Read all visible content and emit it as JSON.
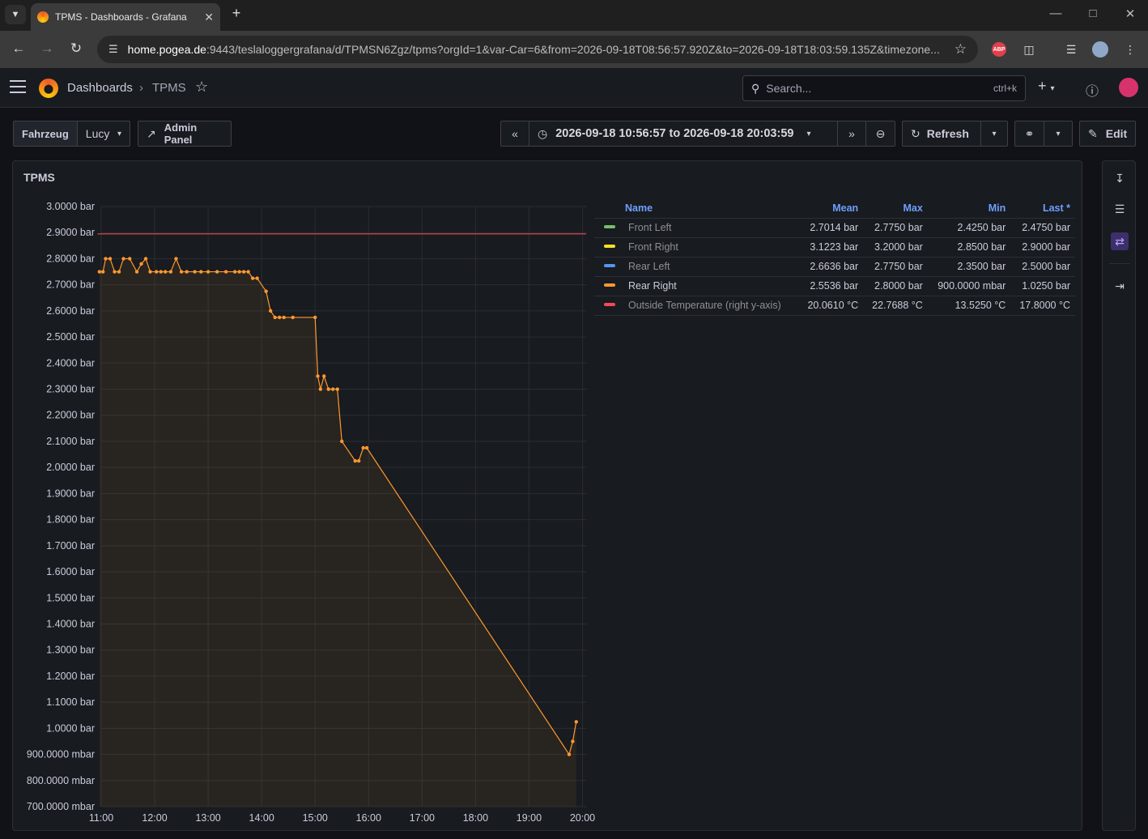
{
  "browser": {
    "tab_title": "TPMS - Dashboards - Grafana",
    "url_host": "home.pogea.de",
    "url_rest": ":9443/teslaloggergrafana/d/TPMSN6Zgz/tpms?orgId=1&var-Car=6&from=2026-09-18T08:56:57.920Z&to=2026-09-18T18:03:59.135Z&timezone..."
  },
  "header": {
    "breadcrumb_root": "Dashboards",
    "breadcrumb_sep": "›",
    "breadcrumb_current": "TPMS",
    "search_placeholder": "Search...",
    "search_shortcut": "ctrl+k"
  },
  "controls": {
    "var_label": "Fahrzeug",
    "var_value": "Lucy",
    "admin_panel": "Admin Panel",
    "time_range": "2026-09-18 10:56:57 to 2026-09-18 20:03:59",
    "refresh": "Refresh",
    "edit": "Edit"
  },
  "panel": {
    "title": "TPMS"
  },
  "legend": {
    "headers": [
      "Name",
      "Mean",
      "Max",
      "Min",
      "Last *"
    ],
    "rows": [
      {
        "name": "Front Left",
        "color": "#73bf69",
        "mean": "2.7014 bar",
        "max": "2.7750 bar",
        "min": "2.4250 bar",
        "last": "2.4750 bar"
      },
      {
        "name": "Front Right",
        "color": "#fade2a",
        "mean": "3.1223 bar",
        "max": "3.2000 bar",
        "min": "2.8500 bar",
        "last": "2.9000 bar"
      },
      {
        "name": "Rear Left",
        "color": "#5794f2",
        "mean": "2.6636 bar",
        "max": "2.7750 bar",
        "min": "2.3500 bar",
        "last": "2.5000 bar"
      },
      {
        "name": "Rear Right",
        "color": "#ff9830",
        "mean": "2.5536 bar",
        "max": "2.8000 bar",
        "min": "900.0000 mbar",
        "last": "1.0250 bar"
      },
      {
        "name": "Outside Temperature (right y-axis)",
        "color": "#f2495c",
        "mean": "20.0610 °C",
        "max": "22.7688 °C",
        "min": "13.5250 °C",
        "last": "17.8000 °C"
      }
    ]
  },
  "chart_data": {
    "type": "line",
    "title": "TPMS",
    "ylim": [
      0.7,
      3.0
    ],
    "y_ticks": [
      "700.0000 mbar",
      "800.0000 mbar",
      "900.0000 mbar",
      "1.0000 bar",
      "1.1000 bar",
      "1.2000 bar",
      "1.3000 bar",
      "1.4000 bar",
      "1.5000 bar",
      "1.6000 bar",
      "1.7000 bar",
      "1.8000 bar",
      "1.9000 bar",
      "2.0000 bar",
      "2.1000 bar",
      "2.2000 bar",
      "2.3000 bar",
      "2.4000 bar",
      "2.5000 bar",
      "2.6000 bar",
      "2.7000 bar",
      "2.8000 bar",
      "2.9000 bar",
      "3.0000 bar"
    ],
    "x_ticks": [
      "11:00",
      "12:00",
      "13:00",
      "14:00",
      "15:00",
      "16:00",
      "17:00",
      "18:00",
      "19:00",
      "20:00"
    ],
    "xlim": [
      "11:00",
      "20:05"
    ],
    "grid": true,
    "series": [
      {
        "name": "Rear Right",
        "color": "#ff9830",
        "x": [
          "10:58",
          "11:02",
          "11:05",
          "11:10",
          "11:15",
          "11:20",
          "11:25",
          "11:32",
          "11:40",
          "11:45",
          "11:50",
          "11:55",
          "12:02",
          "12:07",
          "12:12",
          "12:18",
          "12:24",
          "12:30",
          "12:36",
          "12:45",
          "12:52",
          "13:00",
          "13:10",
          "13:20",
          "13:30",
          "13:35",
          "13:40",
          "13:45",
          "13:50",
          "13:55",
          "14:05",
          "14:10",
          "14:15",
          "14:20",
          "14:25",
          "14:35",
          "15:00",
          "15:03",
          "15:06",
          "15:10",
          "15:15",
          "15:20",
          "15:25",
          "15:30",
          "15:45",
          "15:49",
          "15:54",
          "15:58",
          "19:45",
          "19:49",
          "19:53"
        ],
        "y": [
          2.75,
          2.75,
          2.8,
          2.8,
          2.75,
          2.75,
          2.8,
          2.8,
          2.75,
          2.78,
          2.8,
          2.75,
          2.75,
          2.75,
          2.75,
          2.75,
          2.8,
          2.75,
          2.75,
          2.75,
          2.75,
          2.75,
          2.75,
          2.75,
          2.75,
          2.75,
          2.75,
          2.75,
          2.725,
          2.725,
          2.675,
          2.6,
          2.575,
          2.575,
          2.575,
          2.575,
          2.575,
          2.35,
          2.3,
          2.35,
          2.3,
          2.3,
          2.3,
          2.1,
          2.025,
          2.025,
          2.075,
          2.075,
          0.9,
          0.95,
          1.025
        ]
      },
      {
        "name": "Outside Temperature (right y-axis)",
        "color": "#f2495c",
        "x": [
          "10:56",
          "20:04"
        ],
        "y": [
          2.895,
          2.895
        ]
      }
    ]
  }
}
